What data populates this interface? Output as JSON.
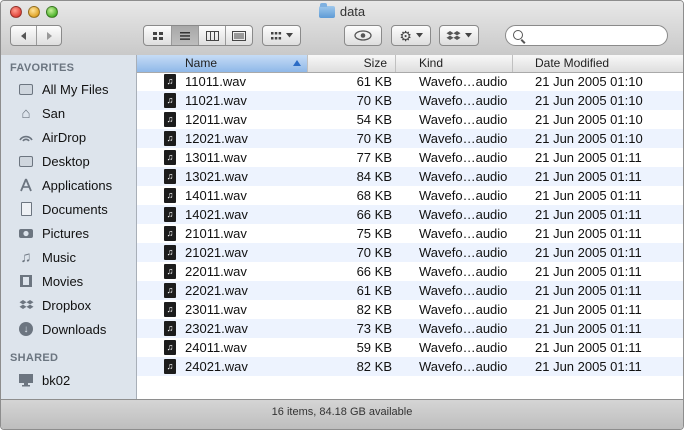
{
  "window": {
    "title": "data"
  },
  "toolbar": {
    "back_icon": "chevron-left-icon",
    "forward_icon": "chevron-right-icon",
    "view_modes": [
      "icon-view",
      "list-view",
      "column-view",
      "coverflow-view"
    ],
    "active_view": "list-view",
    "search": {
      "value": "",
      "placeholder": ""
    }
  },
  "sidebar": {
    "favorites_label": "FAVORITES",
    "favorites": [
      {
        "label": "All My Files",
        "icon": "all-files-icon"
      },
      {
        "label": "San",
        "icon": "home-icon"
      },
      {
        "label": "AirDrop",
        "icon": "airdrop-icon"
      },
      {
        "label": "Desktop",
        "icon": "desktop-icon"
      },
      {
        "label": "Applications",
        "icon": "applications-icon"
      },
      {
        "label": "Documents",
        "icon": "documents-icon"
      },
      {
        "label": "Pictures",
        "icon": "camera-icon"
      },
      {
        "label": "Music",
        "icon": "music-icon"
      },
      {
        "label": "Movies",
        "icon": "film-icon"
      },
      {
        "label": "Dropbox",
        "icon": "dropbox-icon"
      },
      {
        "label": "Downloads",
        "icon": "download-icon"
      }
    ],
    "shared_label": "SHARED",
    "shared": [
      {
        "label": "bk02",
        "icon": "display-icon"
      }
    ]
  },
  "list": {
    "columns": [
      "Name",
      "Size",
      "Kind",
      "Date Modified"
    ],
    "sorted_column": "Name",
    "rows": [
      {
        "name": "11011.wav",
        "size": "61 KB",
        "kind": "Wavefo…audio",
        "date": "21 Jun 2005 01:10"
      },
      {
        "name": "11021.wav",
        "size": "70 KB",
        "kind": "Wavefo…audio",
        "date": "21 Jun 2005 01:10"
      },
      {
        "name": "12011.wav",
        "size": "54 KB",
        "kind": "Wavefo…audio",
        "date": "21 Jun 2005 01:10"
      },
      {
        "name": "12021.wav",
        "size": "70 KB",
        "kind": "Wavefo…audio",
        "date": "21 Jun 2005 01:10"
      },
      {
        "name": "13011.wav",
        "size": "77 KB",
        "kind": "Wavefo…audio",
        "date": "21 Jun 2005 01:11"
      },
      {
        "name": "13021.wav",
        "size": "84 KB",
        "kind": "Wavefo…audio",
        "date": "21 Jun 2005 01:11"
      },
      {
        "name": "14011.wav",
        "size": "68 KB",
        "kind": "Wavefo…audio",
        "date": "21 Jun 2005 01:11"
      },
      {
        "name": "14021.wav",
        "size": "66 KB",
        "kind": "Wavefo…audio",
        "date": "21 Jun 2005 01:11"
      },
      {
        "name": "21011.wav",
        "size": "75 KB",
        "kind": "Wavefo…audio",
        "date": "21 Jun 2005 01:11"
      },
      {
        "name": "21021.wav",
        "size": "70 KB",
        "kind": "Wavefo…audio",
        "date": "21 Jun 2005 01:11"
      },
      {
        "name": "22011.wav",
        "size": "66 KB",
        "kind": "Wavefo…audio",
        "date": "21 Jun 2005 01:11"
      },
      {
        "name": "22021.wav",
        "size": "61 KB",
        "kind": "Wavefo…audio",
        "date": "21 Jun 2005 01:11"
      },
      {
        "name": "23011.wav",
        "size": "82 KB",
        "kind": "Wavefo…audio",
        "date": "21 Jun 2005 01:11"
      },
      {
        "name": "23021.wav",
        "size": "73 KB",
        "kind": "Wavefo…audio",
        "date": "21 Jun 2005 01:11"
      },
      {
        "name": "24011.wav",
        "size": "59 KB",
        "kind": "Wavefo…audio",
        "date": "21 Jun 2005 01:11"
      },
      {
        "name": "24021.wav",
        "size": "82 KB",
        "kind": "Wavefo…audio",
        "date": "21 Jun 2005 01:11"
      }
    ]
  },
  "status": {
    "text": "16 items, 84.18 GB available"
  },
  "colors": {
    "sidebar_bg": "#dde4ec",
    "row_alt": "#edf3fe",
    "sort_header": "#8fb8e8"
  }
}
